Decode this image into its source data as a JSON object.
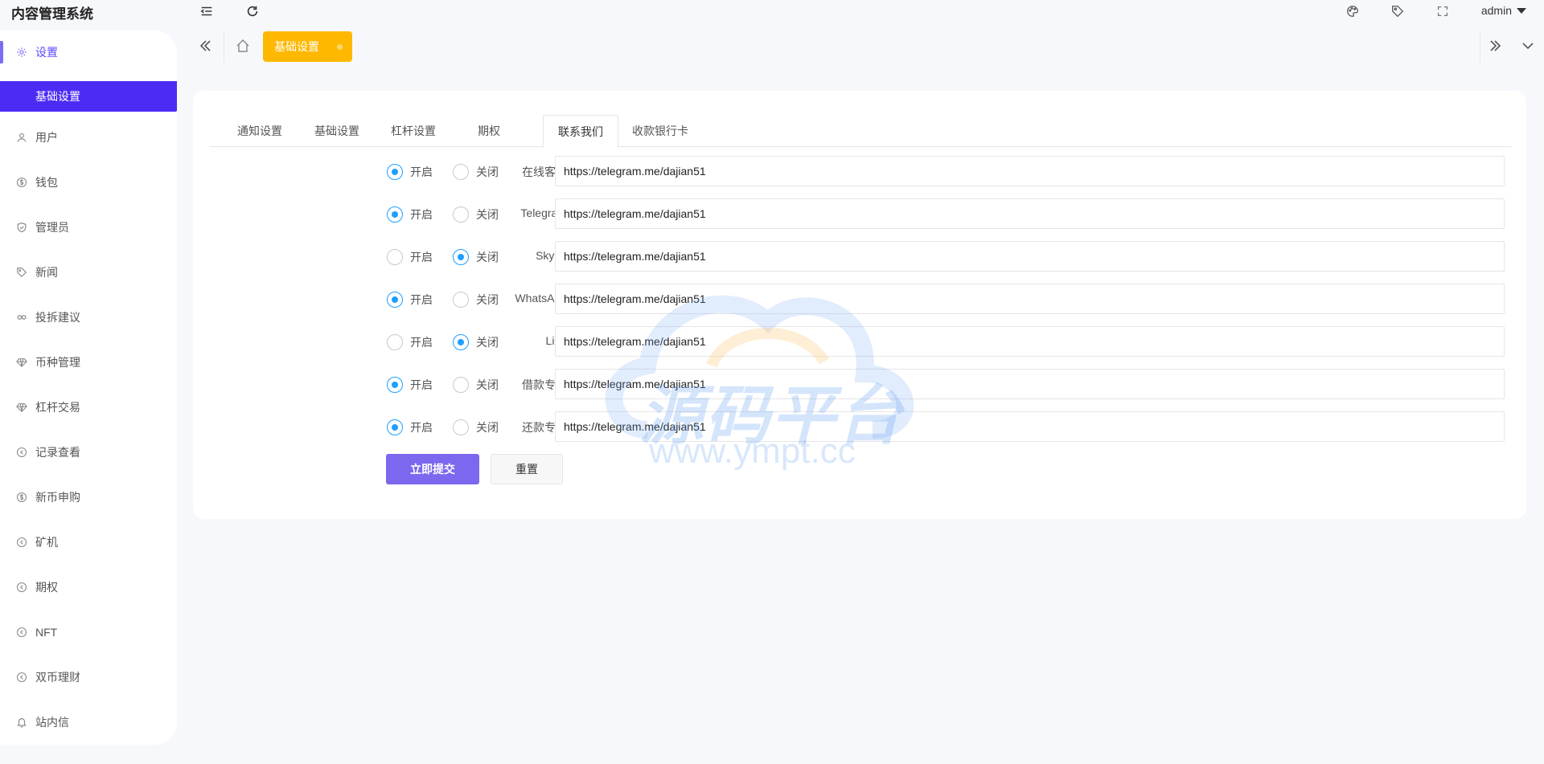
{
  "app": {
    "title": "内容管理系统",
    "user": "admin"
  },
  "sidebar": {
    "group_label": "设置",
    "sub_active": "基础设置",
    "items": [
      {
        "label": "用户",
        "icon": "user-icon"
      },
      {
        "label": "钱包",
        "icon": "dollar-icon"
      },
      {
        "label": "管理员",
        "icon": "shield-icon"
      },
      {
        "label": "新闻",
        "icon": "tag-icon"
      },
      {
        "label": "投拆建议",
        "icon": "link-icon"
      },
      {
        "label": "币种管理",
        "icon": "diamond-icon"
      },
      {
        "label": "杠杆交易",
        "icon": "diamond-icon"
      },
      {
        "label": "记录查看",
        "icon": "circle-arrow-icon"
      },
      {
        "label": "新币申购",
        "icon": "dollar-icon"
      },
      {
        "label": "矿机",
        "icon": "circle-arrow-icon"
      },
      {
        "label": "期权",
        "icon": "circle-arrow-icon"
      },
      {
        "label": "NFT",
        "icon": "circle-arrow-icon"
      },
      {
        "label": "双币理财",
        "icon": "circle-arrow-icon"
      },
      {
        "label": "站内信",
        "icon": "bell-icon"
      }
    ]
  },
  "tagbar": {
    "active_tag": "基础设置"
  },
  "tabs": [
    {
      "label": "通知设置",
      "active": false
    },
    {
      "label": "基础设置",
      "active": false
    },
    {
      "label": "杠杆设置",
      "active": false
    },
    {
      "label": "期权",
      "active": false
    },
    {
      "label": "联系我们",
      "active": true
    },
    {
      "label": "收款银行卡",
      "active": false
    }
  ],
  "radio_labels": {
    "on": "开启",
    "off": "关闭"
  },
  "contacts": [
    {
      "label": "在线客服",
      "enabled": true,
      "url": "https://telegram.me/dajian51"
    },
    {
      "label": "Telegram",
      "enabled": true,
      "url": "https://telegram.me/dajian51"
    },
    {
      "label": "Skype",
      "enabled": false,
      "url": "https://telegram.me/dajian51"
    },
    {
      "label": "WhatsApp",
      "enabled": true,
      "url": "https://telegram.me/dajian51"
    },
    {
      "label": "Line",
      "enabled": false,
      "url": "https://telegram.me/dajian51"
    },
    {
      "label": "借款专员",
      "enabled": true,
      "url": "https://telegram.me/dajian51"
    },
    {
      "label": "还款专员",
      "enabled": true,
      "url": "https://telegram.me/dajian51"
    }
  ],
  "buttons": {
    "submit": "立即提交",
    "reset": "重置"
  },
  "watermark": {
    "text": "源码平台",
    "url": "www.ympt.cc"
  }
}
